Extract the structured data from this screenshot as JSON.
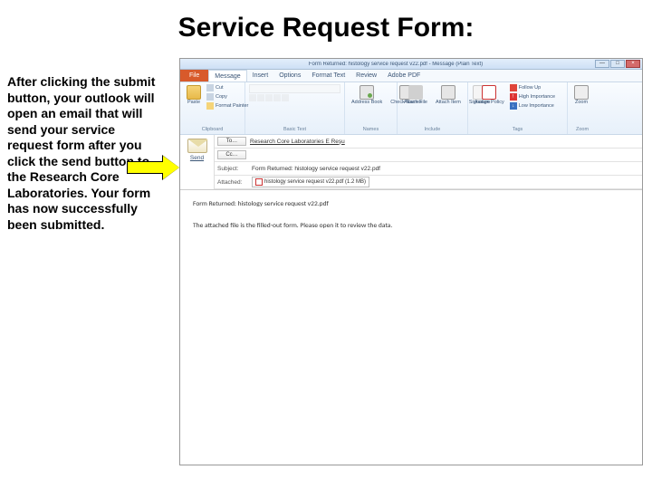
{
  "slide": {
    "title": "Service Request Form:",
    "instruction": "After clicking the submit button, your outlook will open an email that will send your service request form after you click the send button to the Research Core Laboratories. Your form has now successfully been submitted."
  },
  "window": {
    "title": "Form Returned: histology service request v22.pdf - Message (Plain Text)",
    "min": "—",
    "max": "□",
    "close": "×"
  },
  "tabs": {
    "file": "File",
    "items": [
      "Message",
      "Insert",
      "Options",
      "Format Text",
      "Review",
      "Adobe PDF"
    ]
  },
  "ribbon": {
    "clipboard": {
      "paste": "Paste",
      "cut": "Cut",
      "copy": "Copy",
      "format": "Format Painter",
      "label": "Clipboard"
    },
    "basictext": {
      "label": "Basic Text"
    },
    "names": {
      "addr": "Address\nBook",
      "check": "Check\nNames",
      "label": "Names"
    },
    "include": {
      "file": "Attach\nFile",
      "item": "Attach\nItem",
      "sig": "Signature",
      "label": "Include"
    },
    "tags": {
      "assign": "Assign\nPolicy",
      "follow": "Follow Up",
      "high": "High Importance",
      "low": "Low Importance",
      "label": "Tags"
    },
    "zoom": {
      "zoom": "Zoom",
      "label": "Zoom"
    }
  },
  "compose": {
    "send": "Send",
    "to_btn": "To…",
    "to_val": "Research Core Laboratories E Reşu",
    "cc_btn": "Cc…",
    "subject_lbl": "Subject:",
    "subject_val": "Form Returned: histology service request v22.pdf",
    "attached_lbl": "Attached:",
    "attach_name": "histology service request v22.pdf (1.2 MB)"
  },
  "body": {
    "line1": "Form Returned: histology service request v22.pdf",
    "line2": "The attached file is the filled-out form. Please open it to review the data."
  }
}
